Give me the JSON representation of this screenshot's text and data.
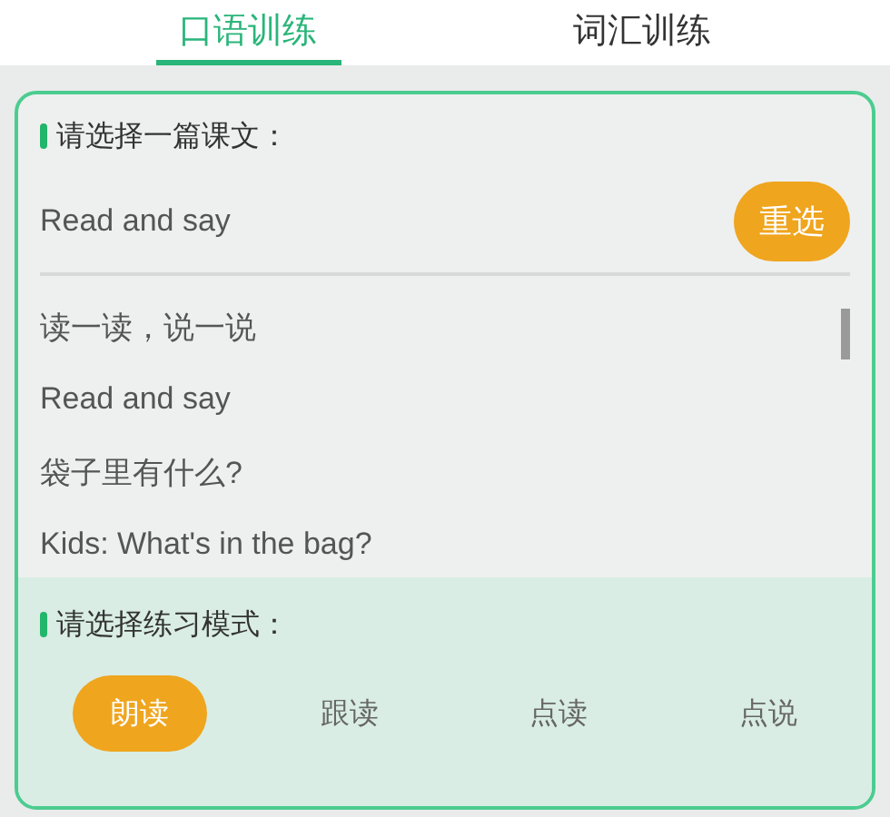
{
  "tabs": [
    {
      "label": "口语训练",
      "selected": true
    },
    {
      "label": "词汇训练",
      "selected": false
    }
  ],
  "lesson_section": {
    "heading": "请选择一篇课文：",
    "current_lesson": "Read and say",
    "reselect_button": "重选",
    "lessons": [
      "读一读，说一说",
      "Read and say",
      "袋子里有什么?",
      "Kids: What's in the bag?"
    ]
  },
  "mode_section": {
    "heading": "请选择练习模式：",
    "modes": [
      {
        "label": "朗读",
        "selected": true
      },
      {
        "label": "跟读",
        "selected": false
      },
      {
        "label": "点读",
        "selected": false
      },
      {
        "label": "点说",
        "selected": false
      }
    ]
  }
}
